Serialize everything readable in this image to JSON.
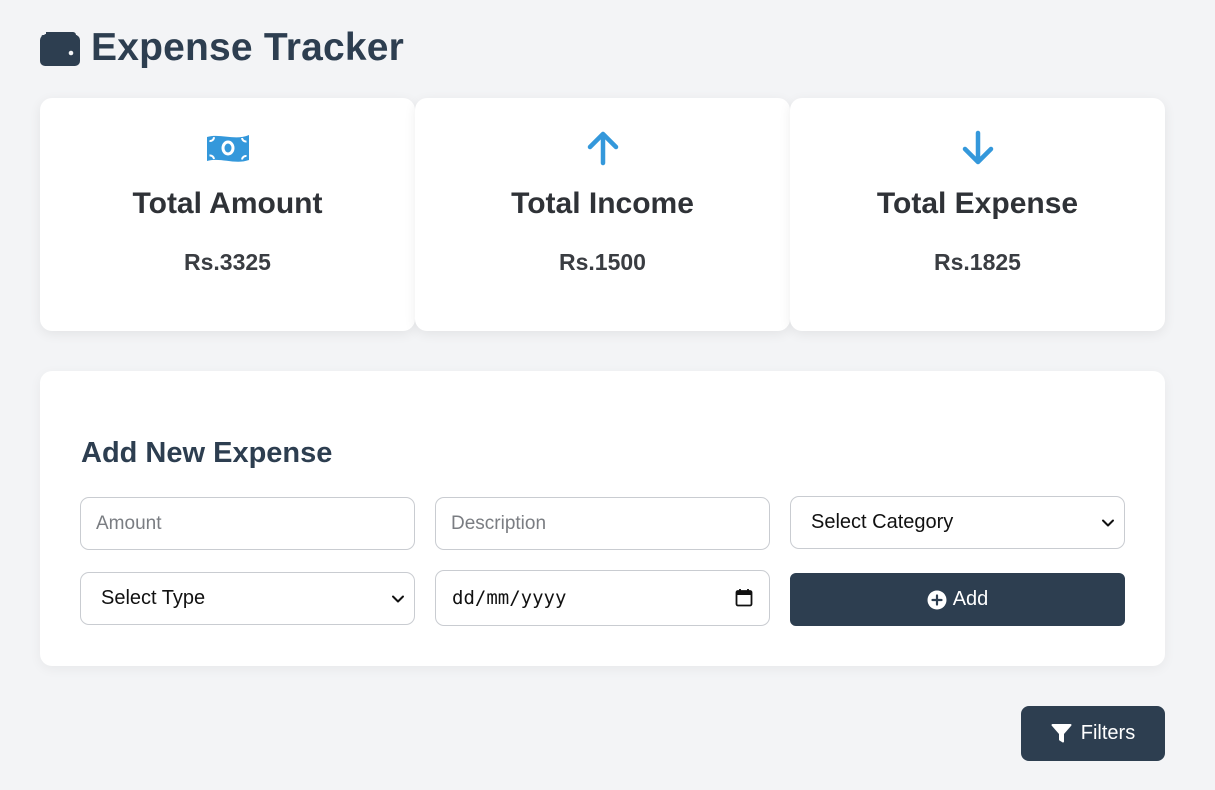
{
  "header": {
    "title": "Expense Tracker",
    "icon": "wallet-icon"
  },
  "summary": {
    "cards": [
      {
        "title": "Total Amount",
        "value": "Rs.3325",
        "icon": "money-bill-icon"
      },
      {
        "title": "Total Income",
        "value": "Rs.1500",
        "icon": "arrow-up-icon"
      },
      {
        "title": "Total Expense",
        "value": "Rs.1825",
        "icon": "arrow-down-icon"
      }
    ]
  },
  "form": {
    "title": "Add New Expense",
    "amount_placeholder": "Amount",
    "description_placeholder": "Description",
    "category_selected": "Select Category",
    "type_selected": "Select Type",
    "date_placeholder": "dd/mm/yyyy",
    "add_label": "Add"
  },
  "filters": {
    "label": "Filters"
  },
  "colors": {
    "accent": "#3498db",
    "primary": "#2d3e50",
    "background": "#f3f4f6",
    "card": "#ffffff"
  }
}
